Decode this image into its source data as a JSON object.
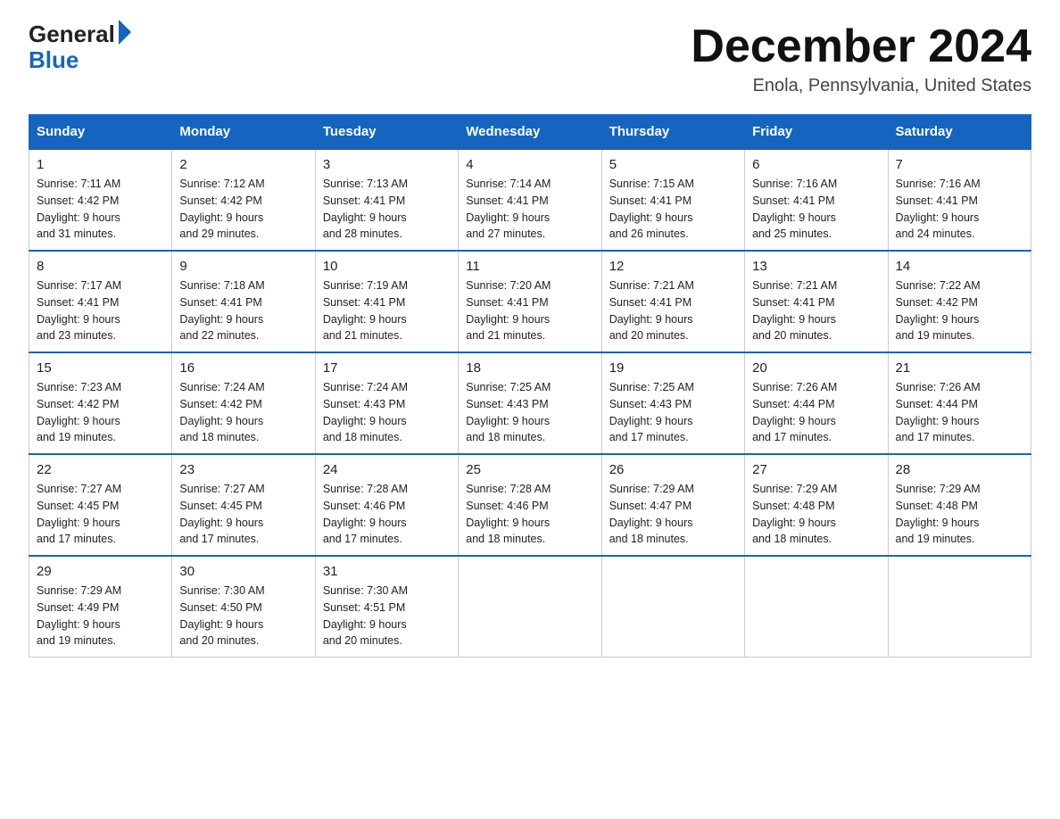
{
  "header": {
    "logo_general": "General",
    "logo_blue": "Blue",
    "title": "December 2024",
    "location": "Enola, Pennsylvania, United States"
  },
  "days_of_week": [
    "Sunday",
    "Monday",
    "Tuesday",
    "Wednesday",
    "Thursday",
    "Friday",
    "Saturday"
  ],
  "weeks": [
    [
      {
        "day": "1",
        "sunrise": "7:11 AM",
        "sunset": "4:42 PM",
        "daylight": "9 hours and 31 minutes."
      },
      {
        "day": "2",
        "sunrise": "7:12 AM",
        "sunset": "4:42 PM",
        "daylight": "9 hours and 29 minutes."
      },
      {
        "day": "3",
        "sunrise": "7:13 AM",
        "sunset": "4:41 PM",
        "daylight": "9 hours and 28 minutes."
      },
      {
        "day": "4",
        "sunrise": "7:14 AM",
        "sunset": "4:41 PM",
        "daylight": "9 hours and 27 minutes."
      },
      {
        "day": "5",
        "sunrise": "7:15 AM",
        "sunset": "4:41 PM",
        "daylight": "9 hours and 26 minutes."
      },
      {
        "day": "6",
        "sunrise": "7:16 AM",
        "sunset": "4:41 PM",
        "daylight": "9 hours and 25 minutes."
      },
      {
        "day": "7",
        "sunrise": "7:16 AM",
        "sunset": "4:41 PM",
        "daylight": "9 hours and 24 minutes."
      }
    ],
    [
      {
        "day": "8",
        "sunrise": "7:17 AM",
        "sunset": "4:41 PM",
        "daylight": "9 hours and 23 minutes."
      },
      {
        "day": "9",
        "sunrise": "7:18 AM",
        "sunset": "4:41 PM",
        "daylight": "9 hours and 22 minutes."
      },
      {
        "day": "10",
        "sunrise": "7:19 AM",
        "sunset": "4:41 PM",
        "daylight": "9 hours and 21 minutes."
      },
      {
        "day": "11",
        "sunrise": "7:20 AM",
        "sunset": "4:41 PM",
        "daylight": "9 hours and 21 minutes."
      },
      {
        "day": "12",
        "sunrise": "7:21 AM",
        "sunset": "4:41 PM",
        "daylight": "9 hours and 20 minutes."
      },
      {
        "day": "13",
        "sunrise": "7:21 AM",
        "sunset": "4:41 PM",
        "daylight": "9 hours and 20 minutes."
      },
      {
        "day": "14",
        "sunrise": "7:22 AM",
        "sunset": "4:42 PM",
        "daylight": "9 hours and 19 minutes."
      }
    ],
    [
      {
        "day": "15",
        "sunrise": "7:23 AM",
        "sunset": "4:42 PM",
        "daylight": "9 hours and 19 minutes."
      },
      {
        "day": "16",
        "sunrise": "7:24 AM",
        "sunset": "4:42 PM",
        "daylight": "9 hours and 18 minutes."
      },
      {
        "day": "17",
        "sunrise": "7:24 AM",
        "sunset": "4:43 PM",
        "daylight": "9 hours and 18 minutes."
      },
      {
        "day": "18",
        "sunrise": "7:25 AM",
        "sunset": "4:43 PM",
        "daylight": "9 hours and 18 minutes."
      },
      {
        "day": "19",
        "sunrise": "7:25 AM",
        "sunset": "4:43 PM",
        "daylight": "9 hours and 17 minutes."
      },
      {
        "day": "20",
        "sunrise": "7:26 AM",
        "sunset": "4:44 PM",
        "daylight": "9 hours and 17 minutes."
      },
      {
        "day": "21",
        "sunrise": "7:26 AM",
        "sunset": "4:44 PM",
        "daylight": "9 hours and 17 minutes."
      }
    ],
    [
      {
        "day": "22",
        "sunrise": "7:27 AM",
        "sunset": "4:45 PM",
        "daylight": "9 hours and 17 minutes."
      },
      {
        "day": "23",
        "sunrise": "7:27 AM",
        "sunset": "4:45 PM",
        "daylight": "9 hours and 17 minutes."
      },
      {
        "day": "24",
        "sunrise": "7:28 AM",
        "sunset": "4:46 PM",
        "daylight": "9 hours and 17 minutes."
      },
      {
        "day": "25",
        "sunrise": "7:28 AM",
        "sunset": "4:46 PM",
        "daylight": "9 hours and 18 minutes."
      },
      {
        "day": "26",
        "sunrise": "7:29 AM",
        "sunset": "4:47 PM",
        "daylight": "9 hours and 18 minutes."
      },
      {
        "day": "27",
        "sunrise": "7:29 AM",
        "sunset": "4:48 PM",
        "daylight": "9 hours and 18 minutes."
      },
      {
        "day": "28",
        "sunrise": "7:29 AM",
        "sunset": "4:48 PM",
        "daylight": "9 hours and 19 minutes."
      }
    ],
    [
      {
        "day": "29",
        "sunrise": "7:29 AM",
        "sunset": "4:49 PM",
        "daylight": "9 hours and 19 minutes."
      },
      {
        "day": "30",
        "sunrise": "7:30 AM",
        "sunset": "4:50 PM",
        "daylight": "9 hours and 20 minutes."
      },
      {
        "day": "31",
        "sunrise": "7:30 AM",
        "sunset": "4:51 PM",
        "daylight": "9 hours and 20 minutes."
      },
      null,
      null,
      null,
      null
    ]
  ],
  "labels": {
    "sunrise": "Sunrise:",
    "sunset": "Sunset:",
    "daylight": "Daylight:"
  }
}
